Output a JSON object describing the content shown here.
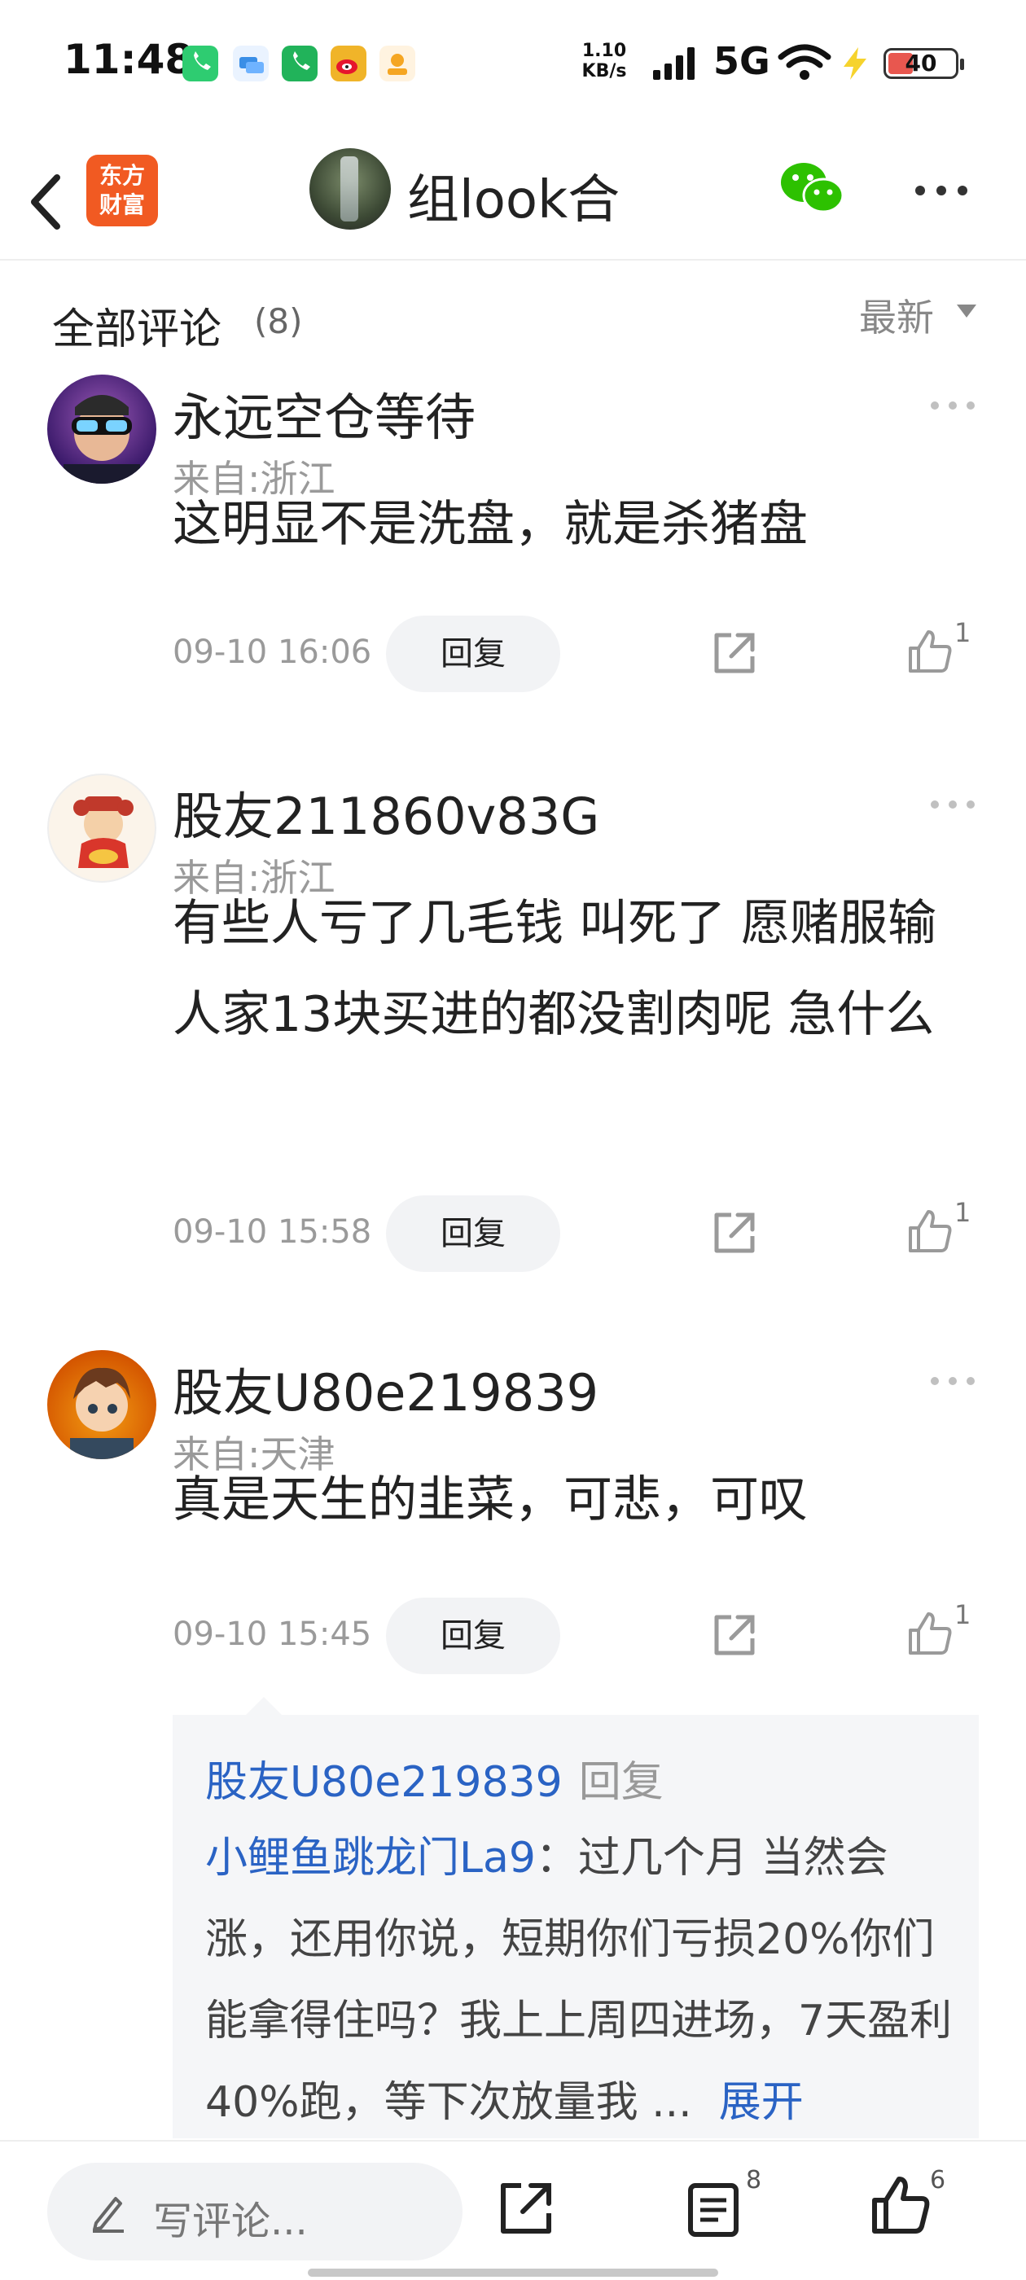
{
  "status_bar": {
    "time": "11:48",
    "app_icons": [
      {
        "name": "phone-green-icon",
        "color": "#2ecc71"
      },
      {
        "name": "message-icon",
        "color": "#3a8ee6"
      },
      {
        "name": "phone-icon",
        "color": "#21b35a"
      },
      {
        "name": "weibo-icon",
        "color": "#f0b429"
      },
      {
        "name": "xiaohongshu-icon",
        "color": "#f5a623"
      }
    ],
    "speed_value": "1.10",
    "speed_unit": "KB/s",
    "network": "5G",
    "battery": "40"
  },
  "nav": {
    "logo_line1": "东方",
    "logo_line2": "财富",
    "title": "组look合",
    "accent": "#f15a22"
  },
  "comments_header": {
    "title": "全部评论",
    "count": "(8)",
    "sort": "最新"
  },
  "comments": [
    {
      "name": "永远空仓等待",
      "location": "来自:浙江",
      "text": "这明显不是洗盘，就是杀猪盘",
      "time": "09-10 16:06",
      "reply_label": "回复",
      "likes": "1"
    },
    {
      "name": "股友211860v83G",
      "location": "来自:浙江",
      "text": "有些人亏了几毛钱 叫死了 愿赌服输 人家13块买进的都没割肉呢 急什么",
      "time": "09-10 15:58",
      "reply_label": "回复",
      "likes": "1"
    },
    {
      "name": "股友U80e219839",
      "location": "来自:天津",
      "text": "真是天生的韭菜，可悲，可叹",
      "time": "09-10 15:45",
      "reply_label": "回复",
      "likes": "1"
    }
  ],
  "reply_thread": {
    "user": "股友U80e219839",
    "verb": "回复",
    "author": "小鲤鱼跳龙门La9",
    "text": "：过几个月 当然会涨，还用你说，短期你们亏损20%你们能拿得住吗？我上上周四进场，7天盈利40%跑，等下次放量我 ...",
    "expand": "展开"
  },
  "bottom_bar": {
    "input_placeholder": "写评论...",
    "comment_count": "8",
    "like_count": "6"
  }
}
